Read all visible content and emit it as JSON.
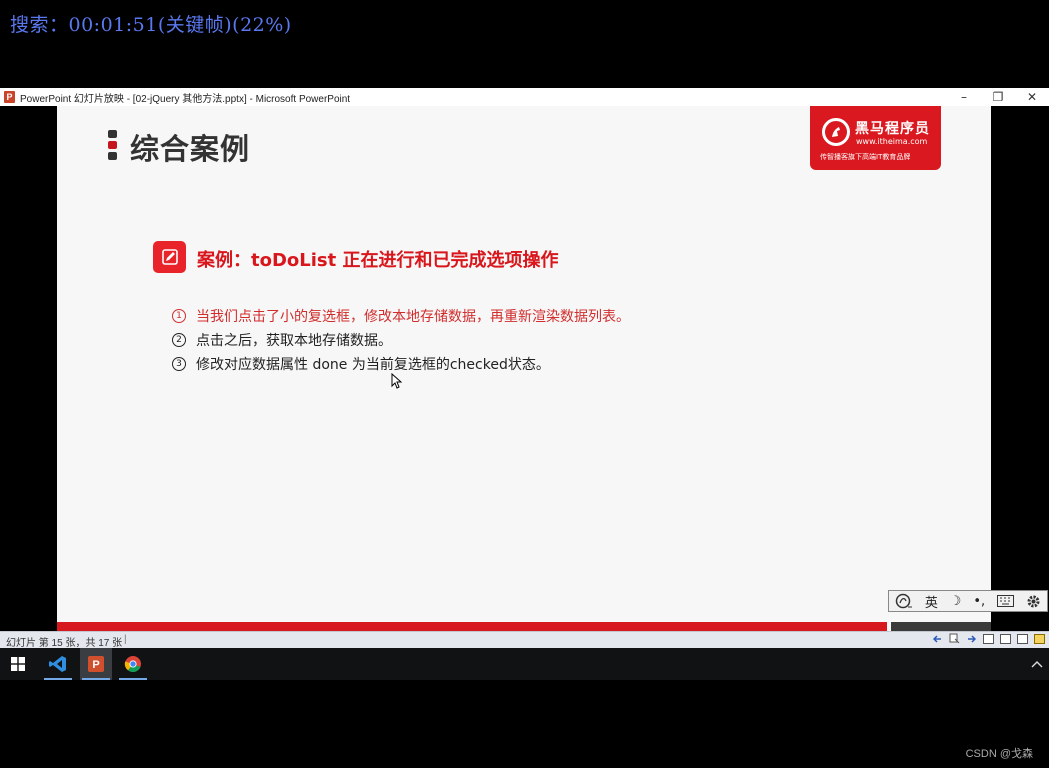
{
  "overlay": {
    "search_status": "搜索：00:01:51(关键帧)(22%)"
  },
  "window": {
    "title": "PowerPoint 幻灯片放映 - [02-jQuery 其他方法.pptx] - Microsoft PowerPoint",
    "app_icon_letter": "P",
    "minimize_glyph": "–",
    "restore_glyph": "❐",
    "close_glyph": "✕"
  },
  "slide": {
    "heading": "综合案例",
    "logo": {
      "name": "黑马程序员",
      "url": "www.itheima.com",
      "tagline": "传智播客旗下高端IT教育品牌"
    },
    "case_title": "案例：toDoList  正在进行和已完成选项操作",
    "items": [
      {
        "num": "1",
        "text": "当我们点击了小的复选框，修改本地存储数据，再重新渲染数据列表。"
      },
      {
        "num": "2",
        "text": "点击之后，获取本地存储数据。"
      },
      {
        "num": "3",
        "text": "修改对应数据属性 done 为当前复选框的checked状态。"
      }
    ],
    "highlight_color": "#d12d2d",
    "accent_color": "#d7181f"
  },
  "ime": {
    "lang": "英",
    "moon_glyph": "☽",
    "punct_glyph": "•,"
  },
  "statusbar": {
    "slide_info": "幻灯片 第 15 张，共 17 张",
    "separator": "|"
  },
  "watermark": "CSDN @戈森"
}
